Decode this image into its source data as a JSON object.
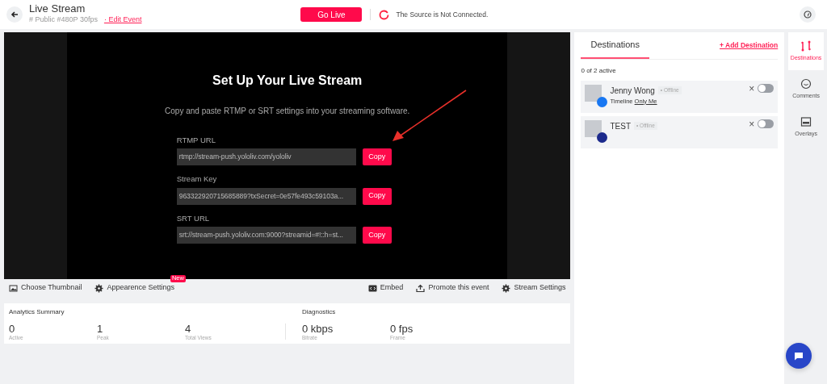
{
  "header": {
    "title": "Live Stream",
    "meta": "# Public #480P 30fps",
    "edit_link": "· Edit Event",
    "go_live": "Go Live",
    "status": "The Source is Not Connected."
  },
  "setup": {
    "title": "Set Up Your Live Stream",
    "subtitle": "Copy and paste RTMP or SRT settings into your streaming software.",
    "fields": [
      {
        "label": "RTMP URL",
        "value": "rtmp://stream-push.yololiv.com/yololiv",
        "button": "Copy"
      },
      {
        "label": "Stream Key",
        "value": "963322920715685889?txSecret=0e57fe493c59103a...",
        "button": "Copy"
      },
      {
        "label": "SRT URL",
        "value": "srt://stream-push.yololiv.com:9000?streamid=#!::h=st...",
        "button": "Copy"
      }
    ]
  },
  "toolbar": {
    "left": [
      {
        "label": "Choose Thumbnail"
      },
      {
        "label": "Appearence Settings",
        "badge": "New"
      }
    ],
    "right": [
      {
        "label": "Embed"
      },
      {
        "label": "Promote this event"
      },
      {
        "label": "Stream Settings"
      }
    ]
  },
  "analytics": {
    "title": "Analytics Summary",
    "stats": [
      {
        "value": "0",
        "label": "Active"
      },
      {
        "value": "1",
        "label": "Peak"
      },
      {
        "value": "4",
        "label": "Total Views"
      }
    ]
  },
  "diagnostics": {
    "title": "Diagnostics",
    "stats": [
      {
        "value": "0 kbps",
        "label": "Bitrate"
      },
      {
        "value": "0 fps",
        "label": "Frame"
      }
    ]
  },
  "destinations": {
    "tab": "Destinations",
    "add": "+ Add Destination",
    "count": "0 of 2 active",
    "items": [
      {
        "name": "Jenny Wong",
        "status": "• Offline",
        "detail": "Timeline",
        "detail_link": "Only Me",
        "remove": "×",
        "on": false
      },
      {
        "name": "TEST",
        "status": "• Offline",
        "remove": "×",
        "on": false
      }
    ]
  },
  "side_tabs": [
    {
      "label": "Destinations",
      "selected": true
    },
    {
      "label": "Comments",
      "selected": false
    },
    {
      "label": "Overlays",
      "selected": false
    }
  ]
}
